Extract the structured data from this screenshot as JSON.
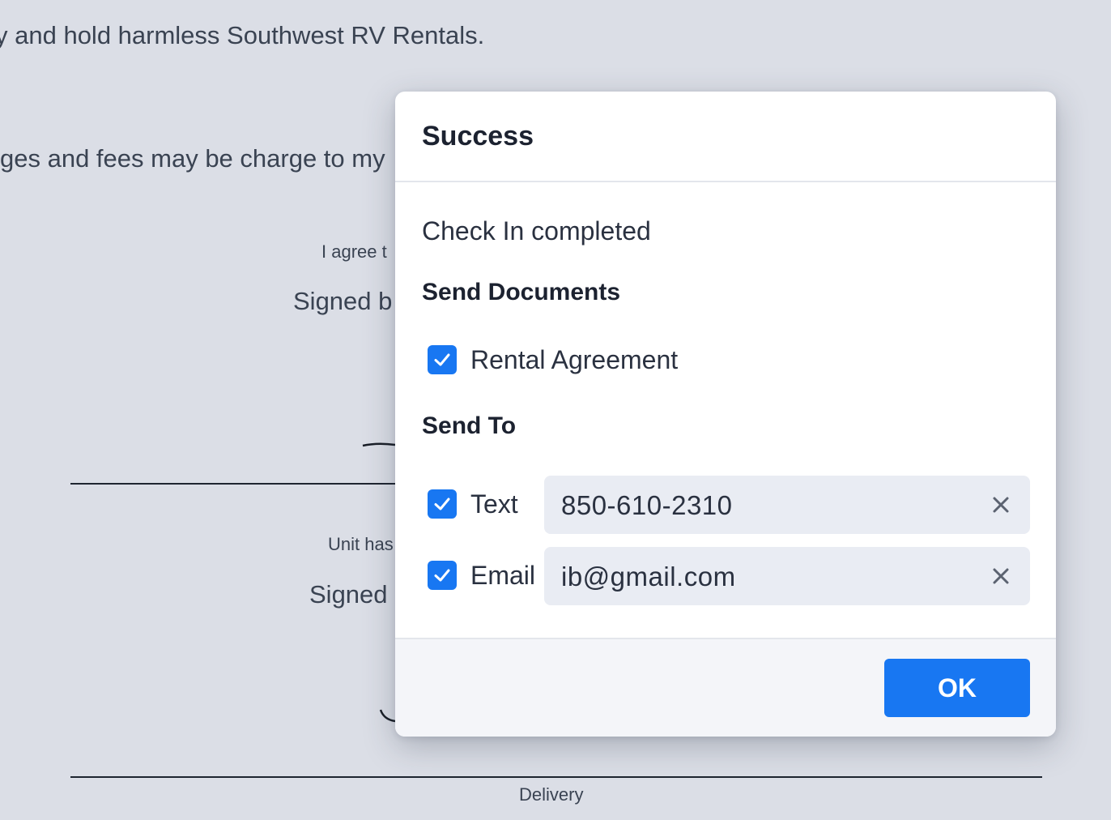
{
  "background": {
    "line1": "y and hold harmless Southwest RV Rentals.",
    "line2": "ges and fees may be charge to my",
    "agree_text": "I agree t",
    "signed_by_1": "Signed b",
    "unit_text": "Unit has",
    "signed_by_2": "Signed",
    "delivery_label": "Delivery"
  },
  "modal": {
    "title": "Success",
    "status": "Check In completed",
    "send_documents_title": "Send Documents",
    "documents": [
      {
        "label": "Rental Agreement",
        "checked": true
      }
    ],
    "send_to_title": "Send To",
    "recipients": [
      {
        "label": "Text",
        "checked": true,
        "value": "850-610-2310"
      },
      {
        "label": "Email",
        "checked": true,
        "value": "ib@gmail.com"
      }
    ],
    "ok_label": "OK"
  },
  "colors": {
    "accent": "#1877f2",
    "background": "#dbdee6",
    "input_bg": "#e9ecf3",
    "footer_bg": "#f4f5f9"
  }
}
